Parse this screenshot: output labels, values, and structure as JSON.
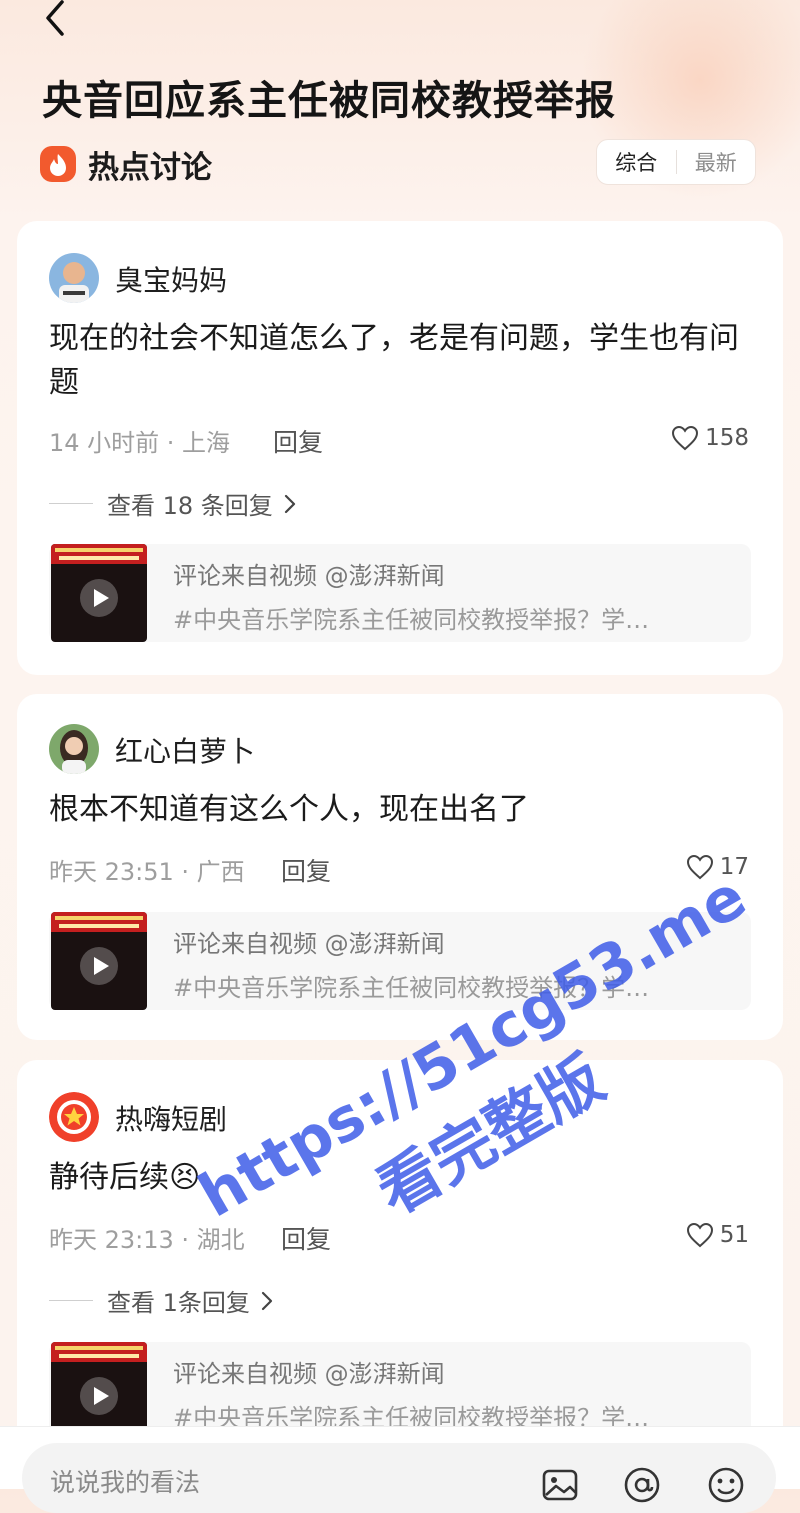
{
  "header": {
    "title": "央音回应系主任被同校教授举报",
    "section_title": "热点讨论",
    "sort": {
      "active": "综合",
      "inactive": "最新"
    }
  },
  "comments": [
    {
      "username": "臭宝妈妈",
      "text": "现在的社会不知道怎么了，老是有问题，学生也有问题",
      "meta": "14 小时前 · 上海",
      "reply_label": "回复",
      "likes": "158",
      "view_replies": "查看 18 条回复",
      "source_line1": "评论来自视频 @澎湃新闻",
      "source_line2": "#中央音乐学院系主任被同校教授举报？学…"
    },
    {
      "username": "红心白萝卜",
      "text": "根本不知道有这么个人，现在出名了",
      "meta": "昨天 23:51 · 广西",
      "reply_label": "回复",
      "likes": "17",
      "source_line1": "评论来自视频 @澎湃新闻",
      "source_line2": "#中央音乐学院系主任被同校教授举报？学…"
    },
    {
      "username": "热嗨短剧",
      "text": "静待后续😣",
      "meta": "昨天 23:13 · 湖北",
      "reply_label": "回复",
      "likes": "51",
      "view_replies": "查看 1条回复",
      "source_line1": "评论来自视频 @澎湃新闻",
      "source_line2": "#中央音乐学院系主任被同校教授举报？学…"
    }
  ],
  "watermark": {
    "line1": "https://51cg53.me",
    "line2": "看完整版"
  },
  "input": {
    "placeholder": "说说我的看法"
  },
  "colors": {
    "accent": "#f25a2e",
    "watermark": "#3f5de8"
  }
}
